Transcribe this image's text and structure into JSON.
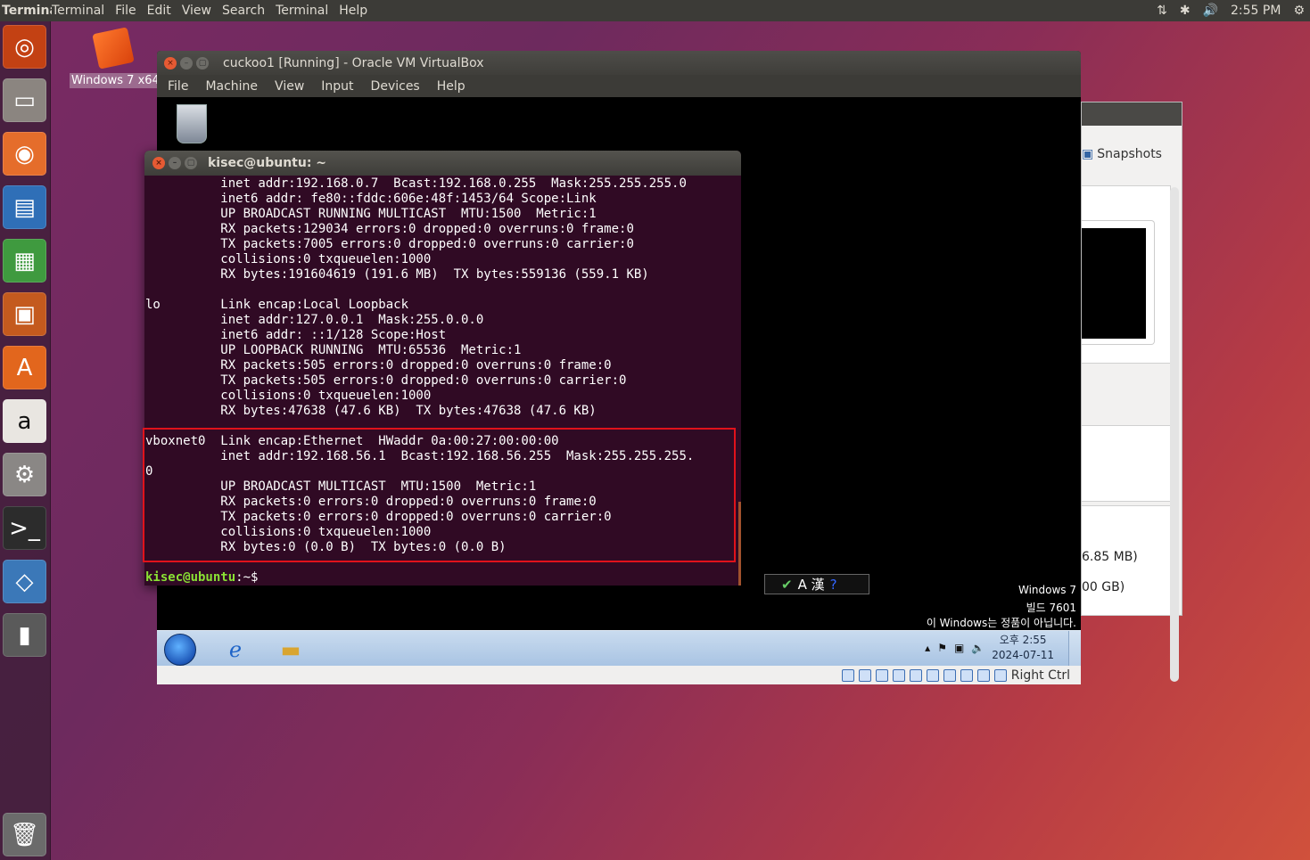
{
  "topbar": {
    "app": "Terminal",
    "menus": [
      "Terminal",
      "File",
      "Edit",
      "View",
      "Search",
      "Terminal",
      "Help"
    ],
    "time": "2:55 PM"
  },
  "desktop": {
    "icon_label": "Windows 7 x64"
  },
  "manager": {
    "snapshots": "Snapshots",
    "mem1": "6.85 MB)",
    "mem2": "00 GB)"
  },
  "vbox": {
    "title": "cuckoo1 [Running] - Oracle VM VirtualBox",
    "menus": [
      "File",
      "Machine",
      "View",
      "Input",
      "Devices",
      "Help"
    ],
    "host_key": "Right Ctrl"
  },
  "guest": {
    "wm1": "Windows 7",
    "wm2": "빌드 7601",
    "wm3": "이 Windows는 정품이 아닙니다.",
    "ime": "A 漢",
    "clock_time": "오후 2:55",
    "clock_date": "2024-07-11"
  },
  "terminal": {
    "title": "kisec@ubuntu: ~",
    "lines": [
      "          inet addr:192.168.0.7  Bcast:192.168.0.255  Mask:255.255.255.0",
      "          inet6 addr: fe80::fddc:606e:48f:1453/64 Scope:Link",
      "          UP BROADCAST RUNNING MULTICAST  MTU:1500  Metric:1",
      "          RX packets:129034 errors:0 dropped:0 overruns:0 frame:0",
      "          TX packets:7005 errors:0 dropped:0 overruns:0 carrier:0",
      "          collisions:0 txqueuelen:1000",
      "          RX bytes:191604619 (191.6 MB)  TX bytes:559136 (559.1 KB)",
      "",
      "lo        Link encap:Local Loopback",
      "          inet addr:127.0.0.1  Mask:255.0.0.0",
      "          inet6 addr: ::1/128 Scope:Host",
      "          UP LOOPBACK RUNNING  MTU:65536  Metric:1",
      "          RX packets:505 errors:0 dropped:0 overruns:0 frame:0",
      "          TX packets:505 errors:0 dropped:0 overruns:0 carrier:0",
      "          collisions:0 txqueuelen:1000",
      "          RX bytes:47638 (47.6 KB)  TX bytes:47638 (47.6 KB)",
      "",
      "vboxnet0  Link encap:Ethernet  HWaddr 0a:00:27:00:00:00",
      "          inet addr:192.168.56.1  Bcast:192.168.56.255  Mask:255.255.255.",
      "0",
      "          UP BROADCAST MULTICAST  MTU:1500  Metric:1",
      "          RX packets:0 errors:0 dropped:0 overruns:0 frame:0",
      "          TX packets:0 errors:0 dropped:0 overruns:0 carrier:0",
      "          collisions:0 txqueuelen:1000",
      "          RX bytes:0 (0.0 B)  TX bytes:0 (0.0 B)",
      ""
    ],
    "prompt": "kisec@ubuntu",
    "prompt_suffix": ":~$"
  },
  "colors": {
    "highlight": "#e0121b",
    "terminal_bg": "#300a24",
    "prompt": "#8ae234"
  }
}
